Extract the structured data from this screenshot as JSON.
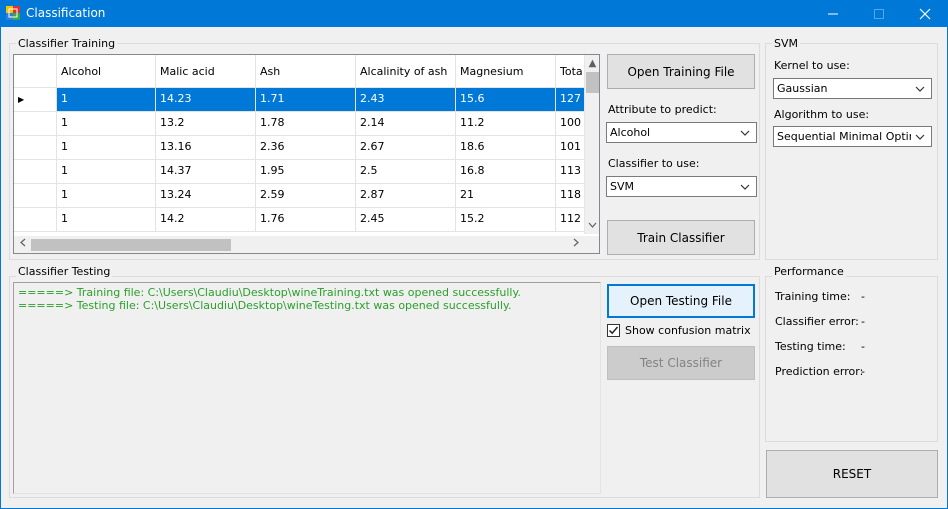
{
  "window": {
    "title": "Classification",
    "controls": {
      "minimize": "—",
      "maximize": "☐",
      "close": "✕"
    }
  },
  "training_group": {
    "label": "Classifier Training",
    "grid": {
      "columns": [
        "Alcohol",
        "Malic acid",
        "Ash",
        "Alcalinity of ash",
        "Magnesium",
        "Tota"
      ],
      "rows": [
        [
          "1",
          "14.23",
          "1.71",
          "2.43",
          "15.6",
          "127"
        ],
        [
          "1",
          "13.2",
          "1.78",
          "2.14",
          "11.2",
          "100"
        ],
        [
          "1",
          "13.16",
          "2.36",
          "2.67",
          "18.6",
          "101"
        ],
        [
          "1",
          "14.37",
          "1.95",
          "2.5",
          "16.8",
          "113"
        ],
        [
          "1",
          "13.24",
          "2.59",
          "2.87",
          "21",
          "118"
        ],
        [
          "1",
          "14.2",
          "1.76",
          "2.45",
          "15.2",
          "112"
        ]
      ],
      "selected_row_index": 0,
      "row_marker": "▶"
    },
    "open_training_button": "Open Training File",
    "attribute_label": "Attribute to predict:",
    "attribute_value": "Alcohol",
    "classifier_label": "Classifier to use:",
    "classifier_value": "SVM",
    "train_button": "Train Classifier"
  },
  "svm_group": {
    "label": "SVM",
    "kernel_label": "Kernel to use:",
    "kernel_value": "Gaussian",
    "algorithm_label": "Algorithm to use:",
    "algorithm_value": "Sequential Minimal Optimizati"
  },
  "testing_group": {
    "label": "Classifier Testing",
    "log_lines": [
      "=====> Training file: C:\\Users\\Claudiu\\Desktop\\wineTraining.txt was opened successfully.",
      "=====> Testing file: C:\\Users\\Claudiu\\Desktop\\wineTesting.txt was opened successfully."
    ],
    "log_color": "#2aa02a",
    "open_testing_button": "Open Testing File",
    "show_confusion_label": "Show confusion matrix",
    "show_confusion_checked": true,
    "test_button": "Test Classifier",
    "test_button_enabled": false
  },
  "performance_group": {
    "label": "Performance",
    "items": [
      {
        "label": "Training time:",
        "value": "-"
      },
      {
        "label": "Classifier error:",
        "value": "-"
      },
      {
        "label": "Testing time:",
        "value": "-"
      },
      {
        "label": "Prediction error:",
        "value": "-"
      }
    ]
  },
  "reset_button": "RESET",
  "colors": {
    "titlebar": "#0078d7",
    "selection": "#0078d7",
    "focus_border": "#0078d7"
  }
}
